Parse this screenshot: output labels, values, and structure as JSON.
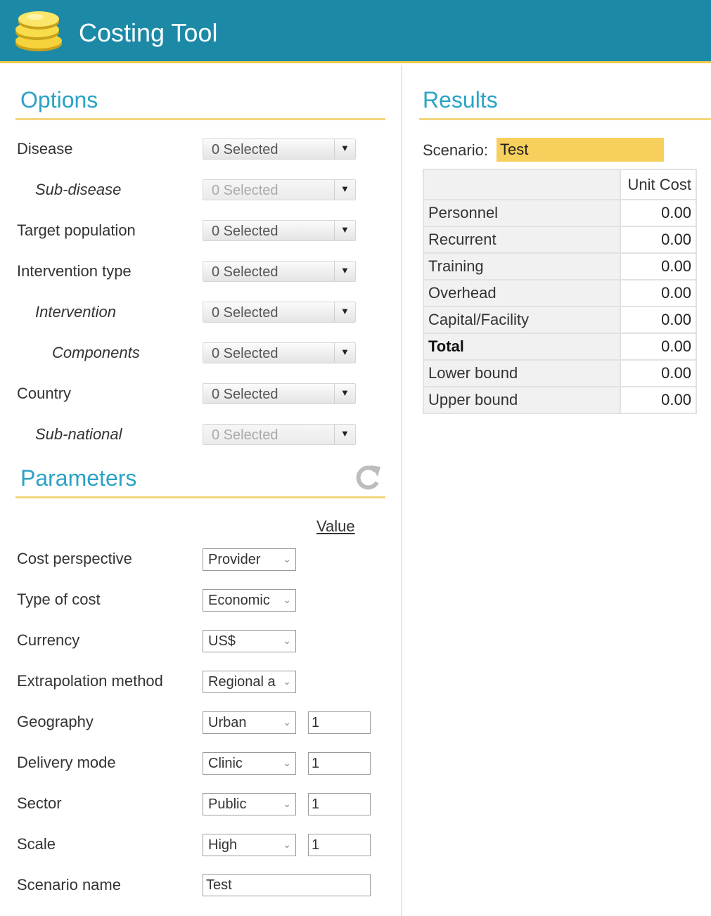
{
  "app": {
    "title": "Costing Tool"
  },
  "options": {
    "title": "Options",
    "rows": [
      {
        "label": "Disease",
        "value": "0 Selected"
      },
      {
        "label": "Sub-disease",
        "value": "0 Selected"
      },
      {
        "label": "Target population",
        "value": "0 Selected"
      },
      {
        "label": "Intervention type",
        "value": "0 Selected"
      },
      {
        "label": "Intervention",
        "value": "0 Selected"
      },
      {
        "label": "Components",
        "value": "0 Selected"
      },
      {
        "label": "Country",
        "value": "0 Selected"
      },
      {
        "label": "Sub-national",
        "value": "0 Selected"
      }
    ]
  },
  "parameters": {
    "title": "Parameters",
    "value_header": "Value",
    "rows": [
      {
        "label": "Cost perspective",
        "select": "Provider"
      },
      {
        "label": "Type of cost",
        "select": "Economic"
      },
      {
        "label": "Currency",
        "select": "US$"
      },
      {
        "label": "Extrapolation method",
        "select": "Regional a"
      },
      {
        "label": "Geography",
        "select": "Urban",
        "value": "1"
      },
      {
        "label": "Delivery mode",
        "select": "Clinic",
        "value": "1"
      },
      {
        "label": "Sector",
        "select": "Public",
        "value": "1"
      },
      {
        "label": "Scale",
        "select": "High",
        "value": "1"
      },
      {
        "label": "Scenario name",
        "text": "Test"
      }
    ]
  },
  "results": {
    "title": "Results",
    "scenario_label": "Scenario:",
    "scenario_value": "Test",
    "column_header": "Unit Cost",
    "rows": [
      {
        "label": "Personnel",
        "value": "0.00"
      },
      {
        "label": "Recurrent",
        "value": "0.00"
      },
      {
        "label": "Training",
        "value": "0.00"
      },
      {
        "label": "Overhead",
        "value": "0.00"
      },
      {
        "label": "Capital/Facility",
        "value": "0.00"
      },
      {
        "label": "Total",
        "value": "0.00"
      },
      {
        "label": "Lower bound",
        "value": "0.00"
      },
      {
        "label": "Upper bound",
        "value": "0.00"
      }
    ]
  },
  "colors": {
    "header": "#1c8aa7",
    "accent_line": "#f3d57a",
    "section_title": "#2aa3c5",
    "scenario_highlight": "#f7cf5c"
  },
  "icons": {
    "logo": "coins-icon",
    "refresh": "refresh-icon",
    "dropdown": "caret-down-icon",
    "select": "chevron-down-icon"
  }
}
